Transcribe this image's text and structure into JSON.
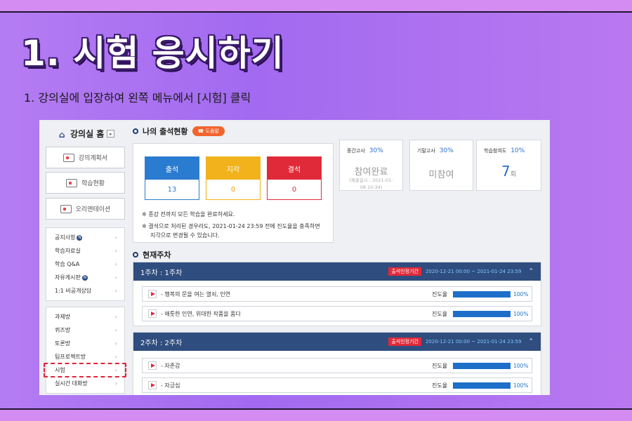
{
  "slide": {
    "title": "1. 시험 응시하기",
    "subtitle": "1. 강의실에 입장하여 왼쪽 메뉴에서 [시험] 클릭"
  },
  "sidebar": {
    "home_label": "강의실 홈",
    "buttons": [
      "강의계획서",
      "학습현황",
      "오리엔테이션"
    ],
    "menu1": [
      "공지사항",
      "학습자료실",
      "학습 Q&A",
      "자유게시판",
      "1:1 비공개상담"
    ],
    "menu2": [
      "과제방",
      "퀴즈방",
      "토론방",
      "팀프로젝트방",
      "시험",
      "실시간 대화방"
    ]
  },
  "attendance": {
    "heading": "나의 출석현황",
    "help": "도움말",
    "cards": [
      {
        "label": "출석",
        "value": "13",
        "color": "#2a7cd0"
      },
      {
        "label": "지각",
        "value": "0",
        "color": "#f2b21c"
      },
      {
        "label": "결석",
        "value": "0",
        "color": "#e02a3a"
      }
    ],
    "note1": "※  종강 전까지 모든 학습을 완료하세요.",
    "note2a": "※  결석으로 처리된 경우라도, 2021-01-24 23:59 전에 진도율을 충족하면",
    "note2b": "지각으로 변경될 수 있습니다."
  },
  "stats": [
    {
      "label": "중간고사",
      "pct": "30%",
      "main": "참여완료",
      "sub1": "(제출일시 : 2021-01-",
      "sub2": "08 10:34)"
    },
    {
      "label": "기말고사",
      "pct": "30%",
      "main": "미참여"
    },
    {
      "label": "학습참여도",
      "pct": "10%",
      "num": "7",
      "unit": "회"
    }
  ],
  "current": {
    "heading": "현재주차",
    "weeks": [
      {
        "title": "1주차 : 1주차",
        "tag": "출석인정기간",
        "period": "2020-12-21 00:00 ~ 2021-01-24 23:59",
        "lessons": [
          {
            "name": "- 행복의 문을 여는 열쇠, 인연",
            "prog_label": "진도율",
            "progress": "100%"
          },
          {
            "name": "- 애틋한 인연, 위대한 작품을 품다",
            "prog_label": "진도율",
            "progress": "100%"
          }
        ]
      },
      {
        "title": "2주차 : 2주차",
        "tag": "출석인정기간",
        "period": "2020-12-21 00:00 ~ 2021-01-24 23:59",
        "lessons": [
          {
            "name": "- 자존감",
            "prog_label": "진도율",
            "progress": "100%"
          },
          {
            "name": "- 자긍심",
            "prog_label": "진도율",
            "progress": "100%"
          }
        ]
      }
    ]
  }
}
